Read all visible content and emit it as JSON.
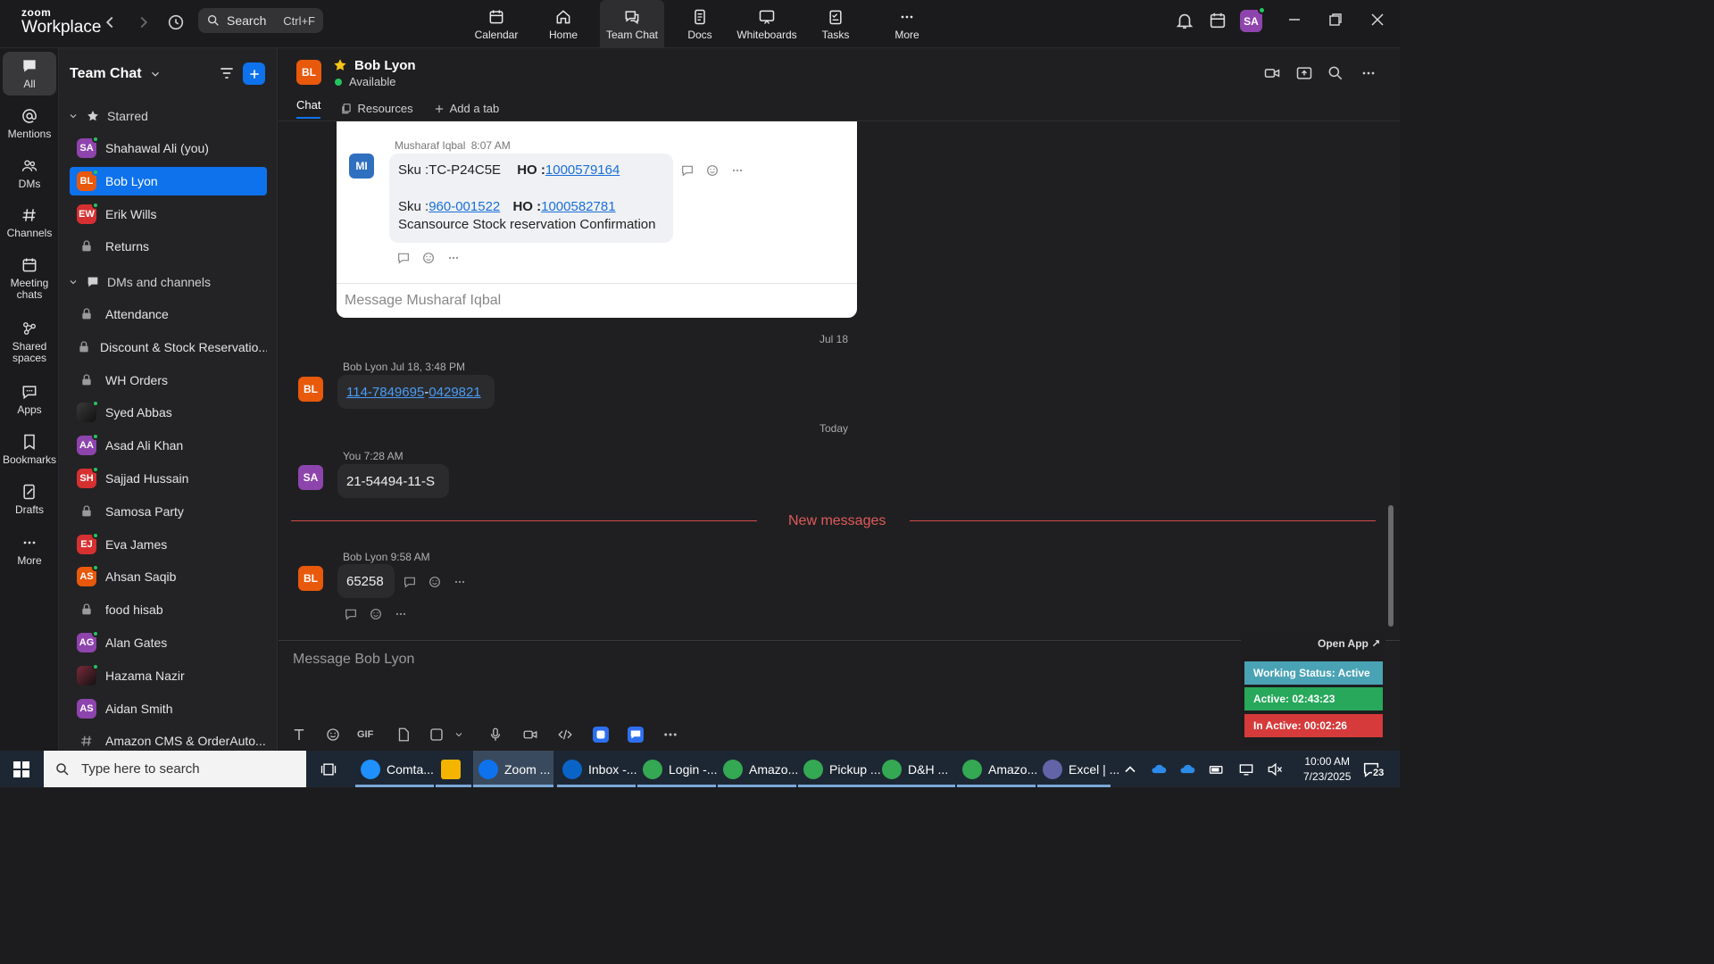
{
  "app": {
    "logo_top": "zoom",
    "logo_bottom": "Workplace"
  },
  "search": {
    "label": "Search",
    "shortcut": "Ctrl+F"
  },
  "top_nav": [
    {
      "label": "Calendar",
      "icon": "calendar-icon"
    },
    {
      "label": "Home",
      "icon": "home-icon"
    },
    {
      "label": "Team Chat",
      "icon": "chat-icon",
      "active": true
    },
    {
      "label": "Docs",
      "icon": "docs-icon"
    },
    {
      "label": "Whiteboards",
      "icon": "whiteboard-icon"
    },
    {
      "label": "Tasks",
      "icon": "tasks-icon"
    },
    {
      "label": "More",
      "icon": "more-icon"
    }
  ],
  "user": {
    "initials": "SA",
    "color": "#8e44ad"
  },
  "rail": [
    {
      "label": "All",
      "active": true
    },
    {
      "label": "Mentions"
    },
    {
      "label": "DMs"
    },
    {
      "label": "Channels"
    },
    {
      "label": "Meeting chats"
    },
    {
      "label": "Shared spaces"
    },
    {
      "label": "Apps"
    },
    {
      "label": "Bookmarks"
    },
    {
      "label": "Drafts"
    },
    {
      "label": "More"
    }
  ],
  "sidebar": {
    "title": "Team Chat",
    "starred_label": "Starred",
    "dms_label": "DMs and channels",
    "starred": [
      {
        "name": "Shahawal Ali (you)",
        "initials": "SA",
        "color": "#8e44ad",
        "online": true
      },
      {
        "name": "Bob Lyon",
        "initials": "BL",
        "color": "#e8590c",
        "online": true,
        "selected": true
      },
      {
        "name": "Erik Wills",
        "initials": "EW",
        "color": "#d63031",
        "online": true
      },
      {
        "name": "Returns",
        "lock": true
      }
    ],
    "items": [
      {
        "name": "Attendance",
        "lock": true
      },
      {
        "name": "Discount & Stock Reservatio...",
        "lock": true
      },
      {
        "name": "WH Orders",
        "lock": true
      },
      {
        "name": "Syed Abbas",
        "initials": "",
        "color": "#3a3a3a",
        "online": true,
        "photo": true
      },
      {
        "name": "Asad Ali Khan",
        "initials": "AA",
        "color": "#8e44ad",
        "online": true
      },
      {
        "name": "Sajjad Hussain",
        "initials": "SH",
        "color": "#d63031",
        "online": true
      },
      {
        "name": "Samosa Party",
        "lock": true
      },
      {
        "name": "Eva James",
        "initials": "EJ",
        "color": "#d63031",
        "online": true
      },
      {
        "name": "Ahsan Saqib",
        "initials": "AS",
        "color": "#e8590c",
        "online": true
      },
      {
        "name": "food hisab",
        "lock": true
      },
      {
        "name": "Alan Gates",
        "initials": "AG",
        "color": "#8e44ad",
        "online": true
      },
      {
        "name": "Hazama Nazir",
        "initials": "",
        "color": "#7a2a3a",
        "online": true,
        "photo": true
      },
      {
        "name": "Aidan Smith",
        "initials": "AS",
        "color": "#8e44ad",
        "online": false
      },
      {
        "name": "Amazon CMS & OrderAuto...",
        "hash": true
      }
    ]
  },
  "chat": {
    "contact_name": "Bob Lyon",
    "contact_initials": "BL",
    "status": "Available",
    "tabs": {
      "chat": "Chat",
      "resources": "Resources",
      "add": "Add a tab"
    },
    "thread": {
      "author": "Musharaf Iqbal",
      "time": "8:07 AM",
      "initials": "MI",
      "line1_sku": "Sku :TC-P24C5E",
      "line1_ho_label": "HO :",
      "line1_ho_link": "1000579164",
      "line2_sku_label": "Sku :",
      "line2_sku_link": "960-001522",
      "line2_ho_label": "HO :",
      "line2_ho_link": "1000582781",
      "line3": "Scansource Stock reservation Confirmation",
      "reply_placeholder": "Message Musharaf Iqbal"
    },
    "date1": "Jul 18",
    "msg1": {
      "author": "Bob Lyon",
      "time": "Jul 18, 3:48 PM",
      "link_a": "114-7849695",
      "sep": "-",
      "link_b": "0429821"
    },
    "date2": "Today",
    "msg2": {
      "author": "You",
      "time": "7:28 AM",
      "initials": "SA",
      "text": "21-54494-11-S"
    },
    "new_messages": "New messages",
    "msg3": {
      "author": "Bob Lyon",
      "time": "9:58 AM",
      "text": "65258"
    },
    "compose_placeholder": "Message Bob Lyon"
  },
  "widget": {
    "open_app": "Open App ↗",
    "working": "Working Status: Active",
    "active": "Active: 02:43:23",
    "inactive": "In Active: 00:02:26"
  },
  "taskbar": {
    "search_placeholder": "Type here to search",
    "apps": [
      {
        "label": "Comta...",
        "color": "#1e90ff"
      },
      {
        "label": "",
        "color": "#f4b400"
      },
      {
        "label": "Zoom ...",
        "color": "#0e72ed",
        "active": true
      },
      {
        "label": "Inbox -...",
        "color": "#0a64c8"
      },
      {
        "label": "Login -...",
        "color": "#34a853"
      },
      {
        "label": "Amazo...",
        "color": "#34a853"
      },
      {
        "label": "Pickup ...",
        "color": "#34a853"
      },
      {
        "label": "D&H ...",
        "color": "#34a853"
      },
      {
        "label": "Amazo...",
        "color": "#34a853"
      },
      {
        "label": "Excel | ...",
        "color": "#6264a7"
      }
    ],
    "time": "10:00 AM",
    "date": "7/23/2025",
    "notif_count": "23"
  }
}
